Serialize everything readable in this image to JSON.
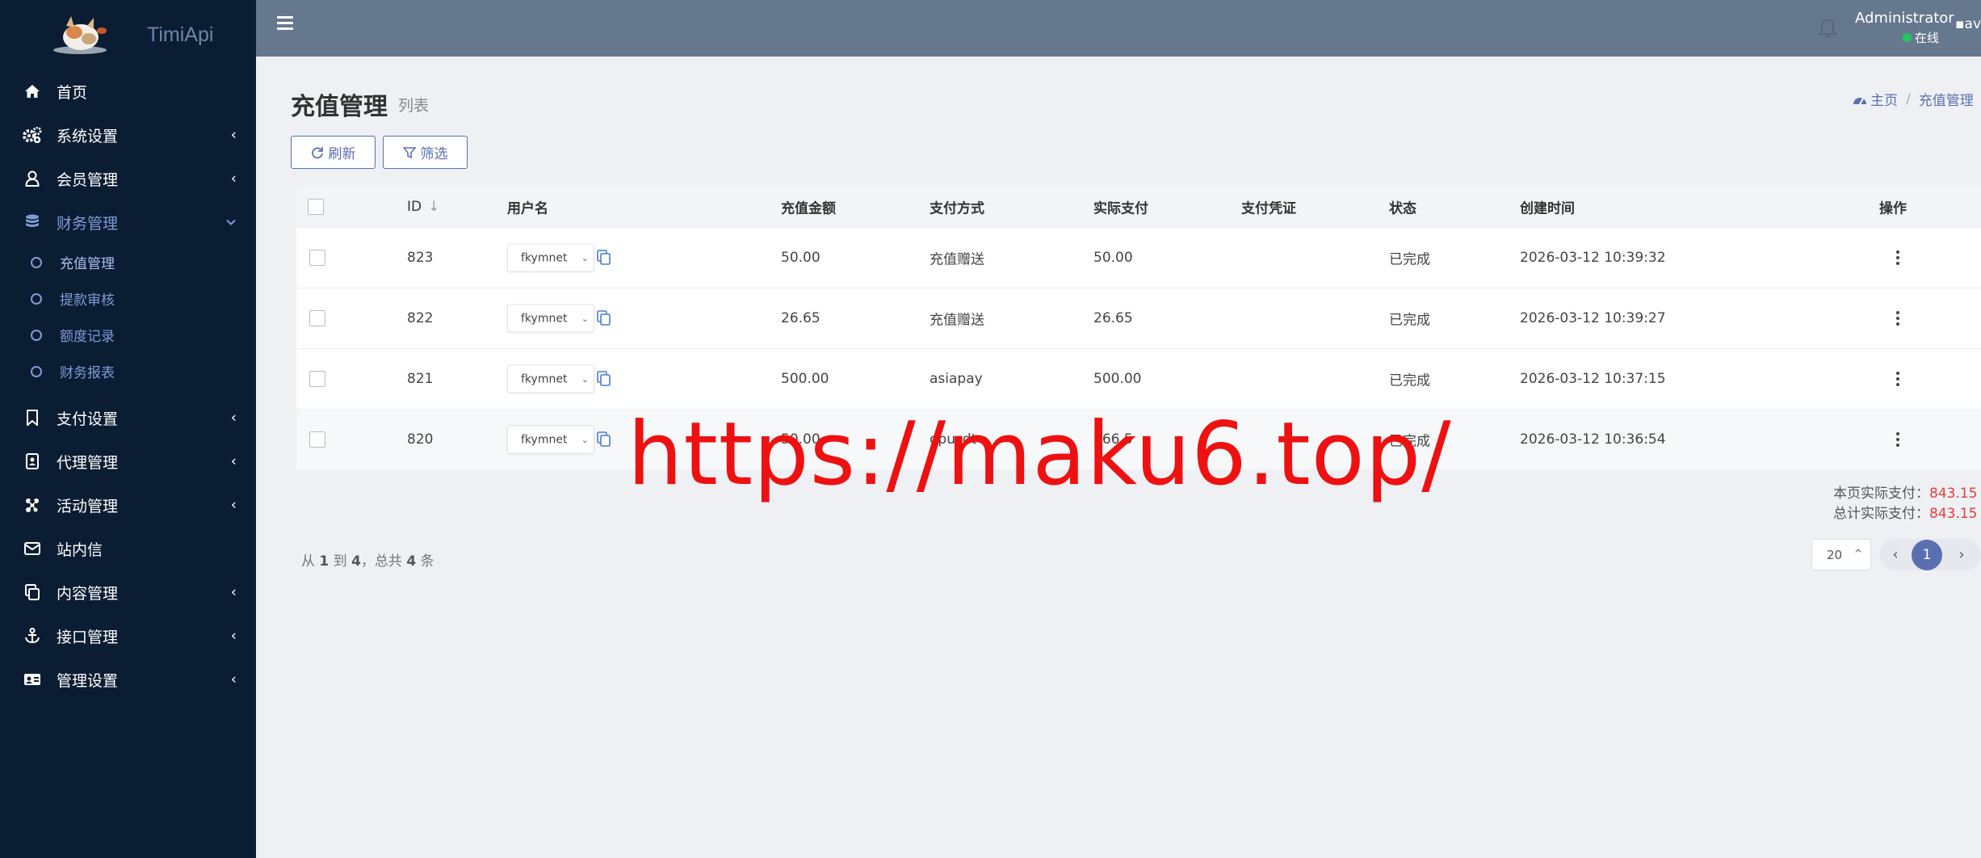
{
  "app": {
    "name": "TimiApi"
  },
  "sidebar": {
    "items": [
      {
        "label": "首页",
        "icon": "home-icon"
      },
      {
        "label": "系统设置",
        "icon": "gears-icon"
      },
      {
        "label": "会员管理",
        "icon": "user-icon"
      },
      {
        "label": "财务管理",
        "icon": "database-icon",
        "active": true,
        "children": [
          "充值管理",
          "提款审核",
          "额度记录",
          "财务报表"
        ]
      },
      {
        "label": "支付设置",
        "icon": "bookmark-icon"
      },
      {
        "label": "代理管理",
        "icon": "address-book-icon"
      },
      {
        "label": "活动管理",
        "icon": "network-icon"
      },
      {
        "label": "站内信",
        "icon": "envelope-icon"
      },
      {
        "label": "内容管理",
        "icon": "copy-icon"
      },
      {
        "label": "接口管理",
        "icon": "anchor-icon"
      },
      {
        "label": "管理设置",
        "icon": "id-card-icon"
      }
    ]
  },
  "header": {
    "user_name": "Administrator",
    "status": "在线",
    "avatar_alt": "av"
  },
  "page": {
    "title": "充值管理",
    "subtitle": "列表"
  },
  "breadcrumb": {
    "home": "主页",
    "current": "充值管理"
  },
  "toolbar": {
    "refresh_label": "刷新",
    "filter_label": "筛选"
  },
  "table": {
    "headers": {
      "id": "ID",
      "user": "用户名",
      "amount": "充值金额",
      "method": "支付方式",
      "actual": "实际支付",
      "voucher": "支付凭证",
      "status": "状态",
      "created": "创建时间",
      "ops": "操作"
    },
    "rows": [
      {
        "id": "823",
        "user": "fkymnet",
        "amount": "50.00",
        "method": "充值赠送",
        "actual": "50.00",
        "voucher": "",
        "status": "已完成",
        "created": "2026-03-12 10:39:32"
      },
      {
        "id": "822",
        "user": "fkymnet",
        "amount": "26.65",
        "method": "充值赠送",
        "actual": "26.65",
        "voucher": "",
        "status": "已完成",
        "created": "2026-03-12 10:39:27"
      },
      {
        "id": "821",
        "user": "fkymnet",
        "amount": "500.00",
        "method": "asiapay",
        "actual": "500.00",
        "voucher": "",
        "status": "已完成",
        "created": "2026-03-12 10:37:15"
      },
      {
        "id": "820",
        "user": "fkymnet",
        "amount": "50.00",
        "method": "opusdt",
        "actual": "266.5",
        "voucher": "",
        "status": "已完成",
        "created": "2026-03-12 10:36:54"
      }
    ]
  },
  "summary": {
    "page_label": "本页实际支付：",
    "page_value": "843.15",
    "total_label": "总计实际支付：",
    "total_value": "843.15"
  },
  "pagination": {
    "from_label": "从",
    "from": "1",
    "to_label": "到",
    "to": "4",
    "total_label": "，总共",
    "total": "4",
    "unit": "条",
    "page_size": "20",
    "current_page": "1"
  },
  "watermark": {
    "text": "https://maku6.top/"
  },
  "colors": {
    "sidebar_bg": "#0b1d33",
    "topbar_bg": "#66788e",
    "accent": "#5a6fb0",
    "red": "#e53e3e",
    "online": "#22c55e"
  }
}
